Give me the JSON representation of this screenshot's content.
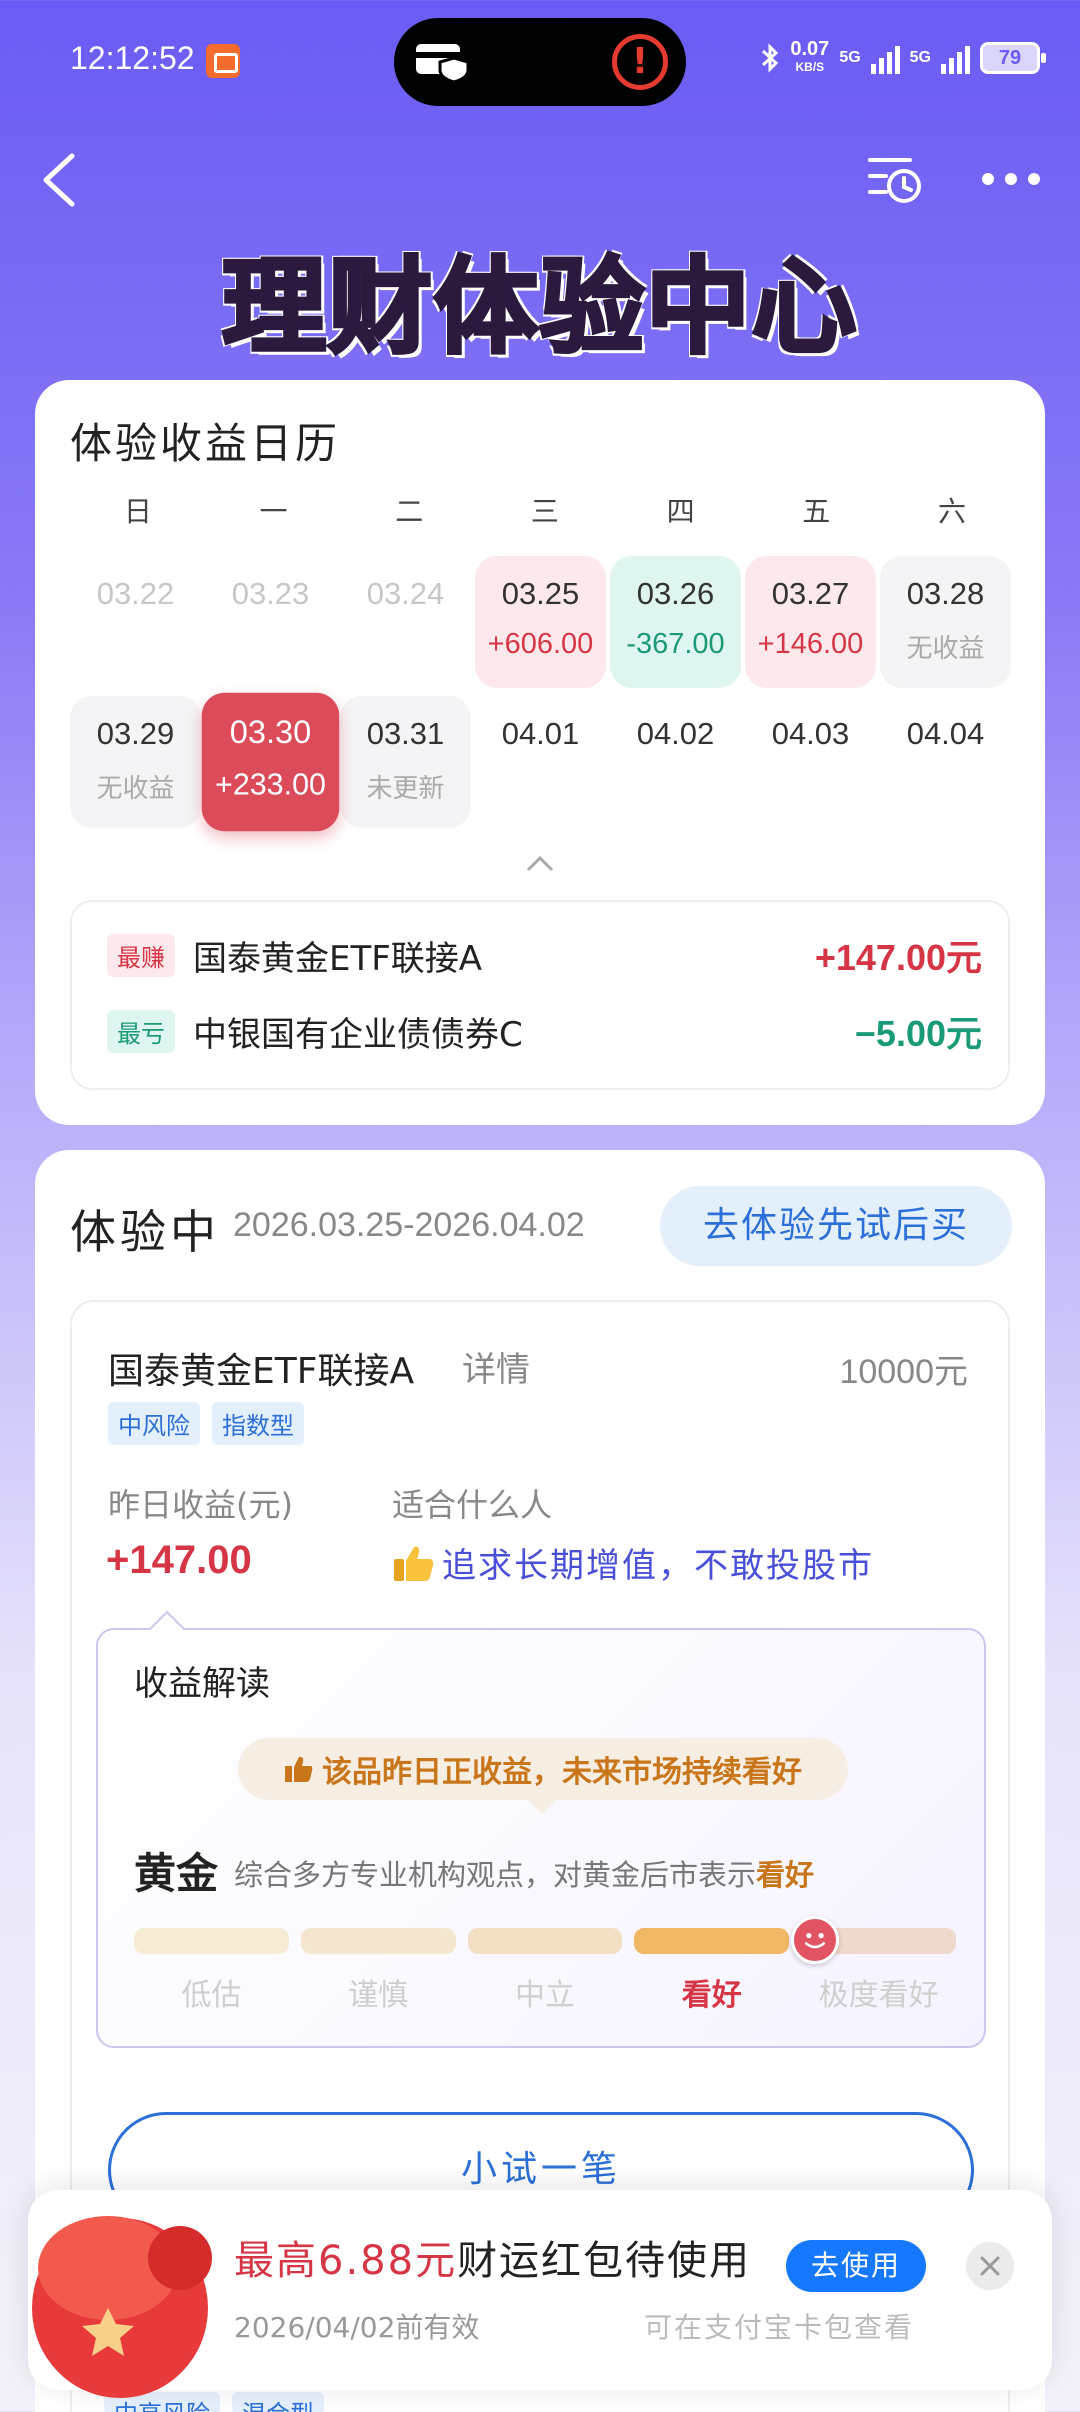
{
  "status_bar": {
    "time": "12:12:52",
    "net_speed_value": "0.07",
    "net_speed_unit": "KB/S",
    "sim1": "5G",
    "sim2": "5G",
    "battery": "79"
  },
  "page": {
    "title": "理财体验中心"
  },
  "calendar": {
    "heading": "体验收益日历",
    "weekdays": [
      "日",
      "一",
      "二",
      "三",
      "四",
      "五",
      "六"
    ],
    "week1": [
      {
        "date": "03.22",
        "value": ""
      },
      {
        "date": "03.23",
        "value": ""
      },
      {
        "date": "03.24",
        "value": ""
      },
      {
        "date": "03.25",
        "value": "+606.00"
      },
      {
        "date": "03.26",
        "value": "-367.00"
      },
      {
        "date": "03.27",
        "value": "+146.00"
      },
      {
        "date": "03.28",
        "value": "无收益"
      }
    ],
    "week2": [
      {
        "date": "03.29",
        "value": "无收益"
      },
      {
        "date": "03.30",
        "value": "+233.00"
      },
      {
        "date": "03.31",
        "value": "未更新"
      },
      {
        "date": "04.01",
        "value": ""
      },
      {
        "date": "04.02",
        "value": ""
      },
      {
        "date": "04.03",
        "value": ""
      },
      {
        "date": "04.04",
        "value": ""
      }
    ],
    "summary": {
      "best_tag": "最赚",
      "best_name": "国泰黄金ETF联接A",
      "best_amount": "+147.00元",
      "worst_tag": "最亏",
      "worst_name": "中银国有企业债债券C",
      "worst_amount": "−5.00元"
    }
  },
  "trial": {
    "heading": "体验中",
    "period": "2026.03.25-2026.04.02",
    "go_button": "去体验先试后买",
    "fund": {
      "name": "国泰黄金ETF联接A",
      "detail_link": "详情",
      "amount": "10000元",
      "tags": [
        "中风险",
        "指数型"
      ],
      "yesterday_label": "昨日收益(元)",
      "yesterday_value": "+147.00",
      "suitable_label": "适合什么人",
      "suitable_value": "追求长期增值，不敢投股市"
    },
    "interpretation": {
      "title": "收益解读",
      "verdict": "该品昨日正收益，未来市场持续看好",
      "asset": "黄金",
      "desc_prefix": "综合多方专业机构观点，对黄金后市表示",
      "desc_highlight": "看好",
      "scale": [
        "低估",
        "谨慎",
        "中立",
        "看好",
        "极度看好"
      ],
      "scale_level": 4
    },
    "try_button": "小试一笔"
  },
  "red_packet": {
    "title_prefix": "最高",
    "title_amount": "6.88元",
    "title_suffix": "财运红包待使用",
    "use_button": "去使用",
    "expire": "2026/04/02前有效",
    "hint": "可在支付宝卡包查看"
  },
  "peek": {
    "tags": [
      "中高风险",
      "混合型"
    ]
  },
  "colors": {
    "positive": "#d63545",
    "negative": "#1b9a78",
    "accent_blue": "#2b6fd8",
    "header_purple": "#6a5cf4"
  }
}
